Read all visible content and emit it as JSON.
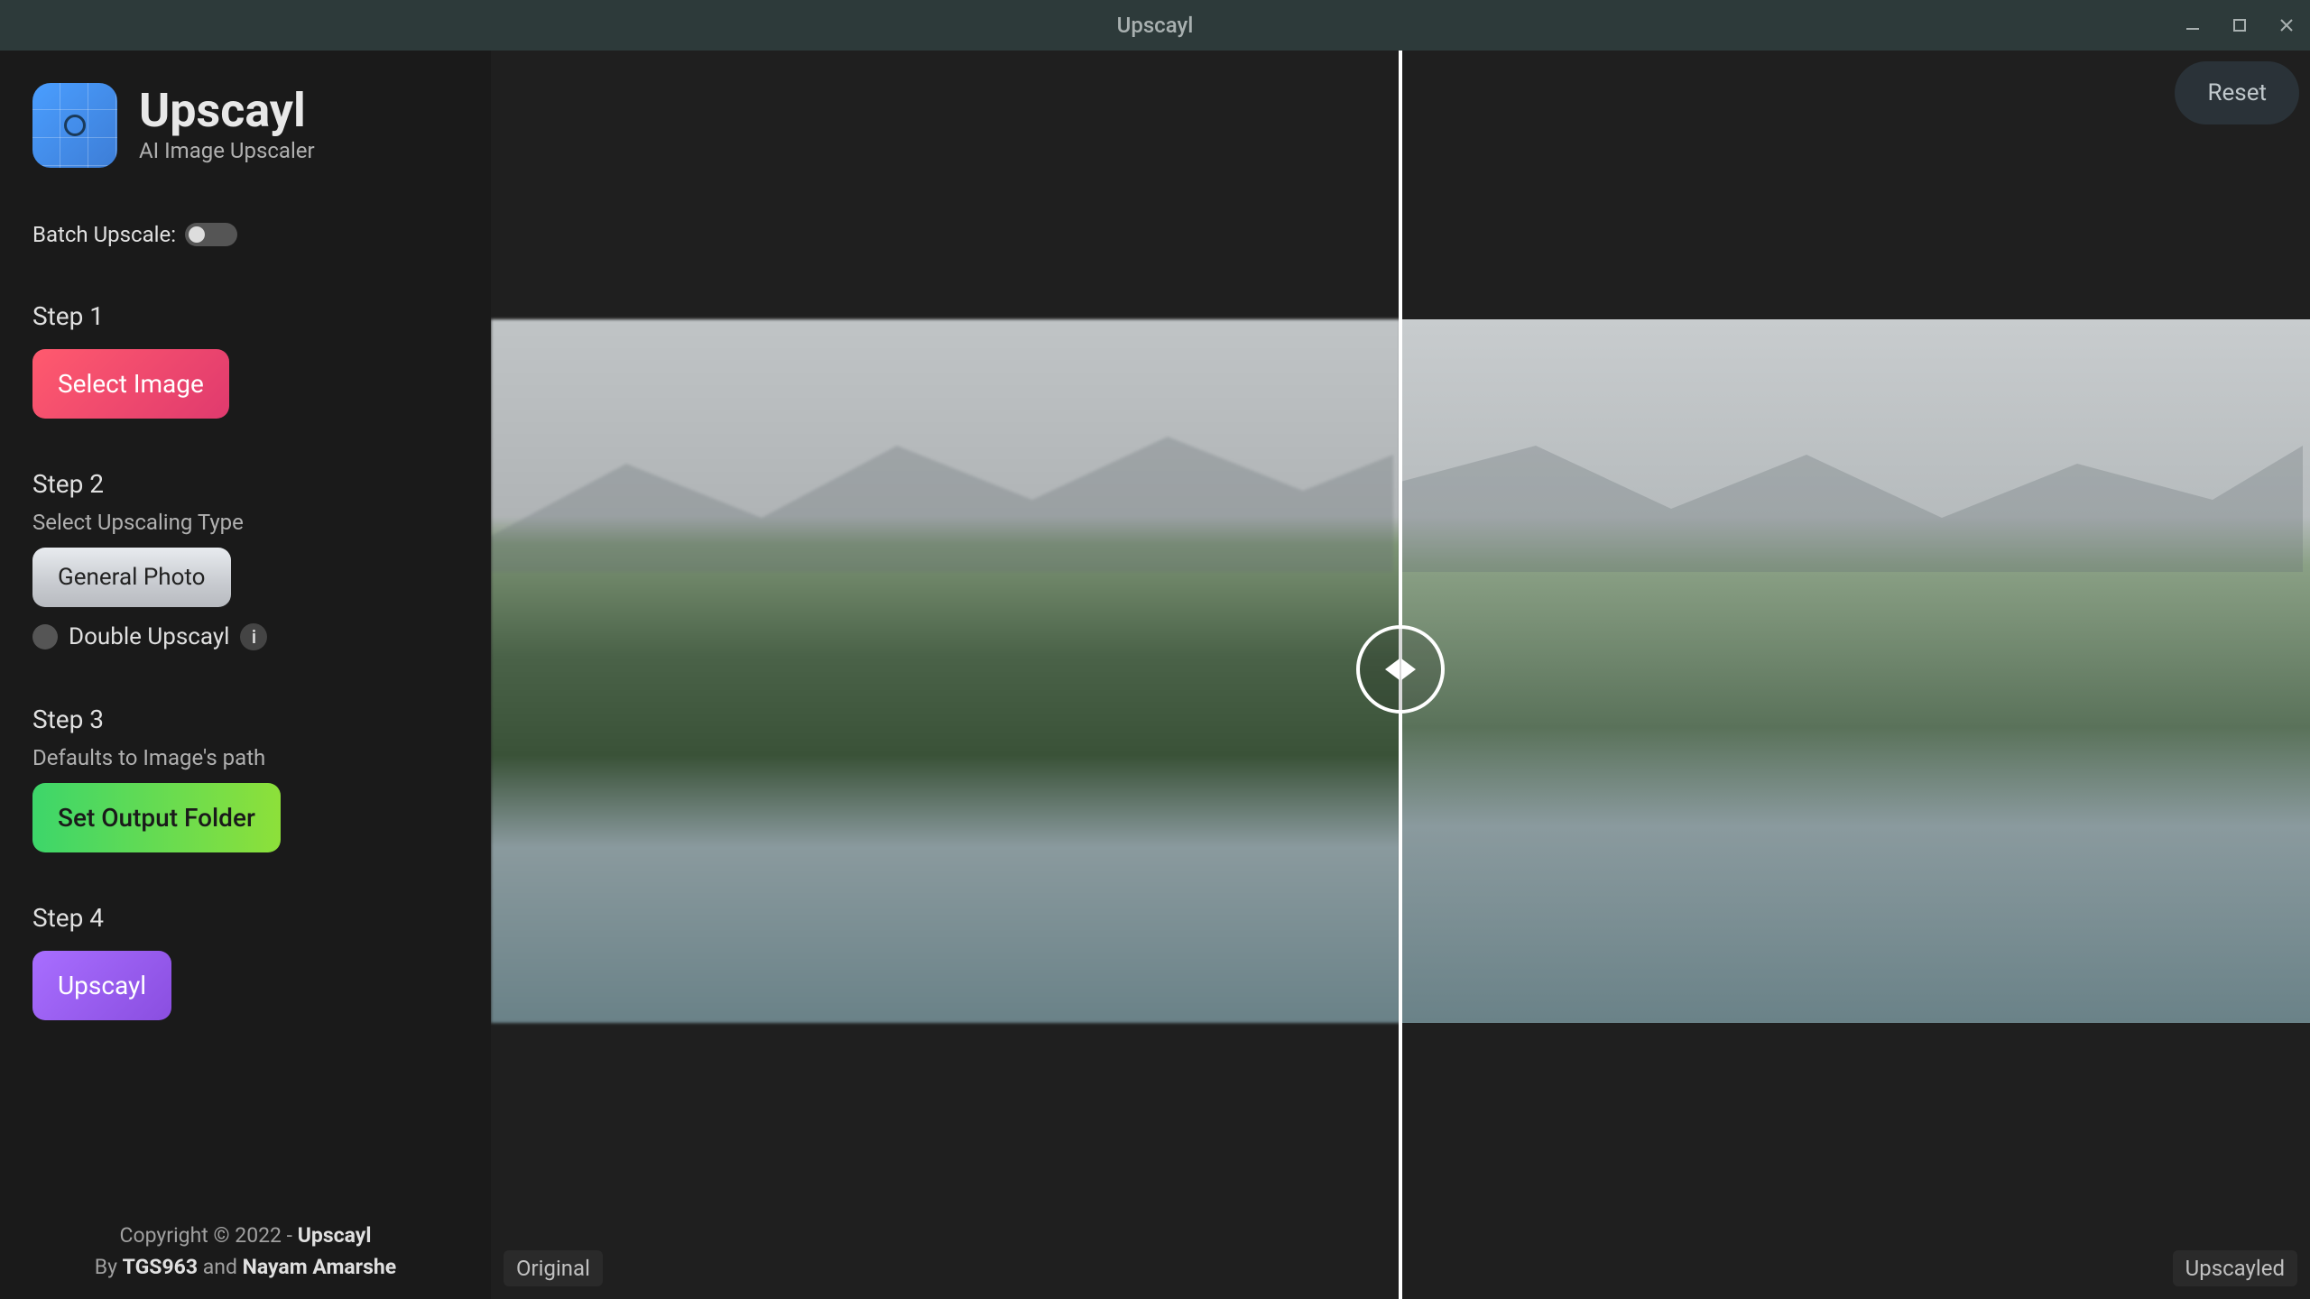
{
  "window": {
    "title": "Upscayl"
  },
  "app": {
    "name": "Upscayl",
    "tagline": "AI Image Upscaler"
  },
  "sidebar": {
    "batch_label": "Batch Upscale:",
    "batch_on": false,
    "step1": {
      "label": "Step 1",
      "button": "Select Image"
    },
    "step2": {
      "label": "Step 2",
      "sublabel": "Select Upscaling Type",
      "selected_model": "General Photo",
      "double_label": "Double Upscayl",
      "double_on": false,
      "info_icon": "i"
    },
    "step3": {
      "label": "Step 3",
      "sublabel": "Defaults to Image's path",
      "button": "Set Output Folder"
    },
    "step4": {
      "label": "Step 4",
      "button": "Upscayl"
    }
  },
  "preview": {
    "reset_label": "Reset",
    "original_label": "Original",
    "upscaled_label": "Upscayled"
  },
  "footer": {
    "line1_prefix": "Copyright © 2022 - ",
    "line1_app": "Upscayl",
    "line2_by": "By ",
    "line2_author1": "TGS963",
    "line2_and": " and ",
    "line2_author2": "Nayam Amarshe"
  }
}
